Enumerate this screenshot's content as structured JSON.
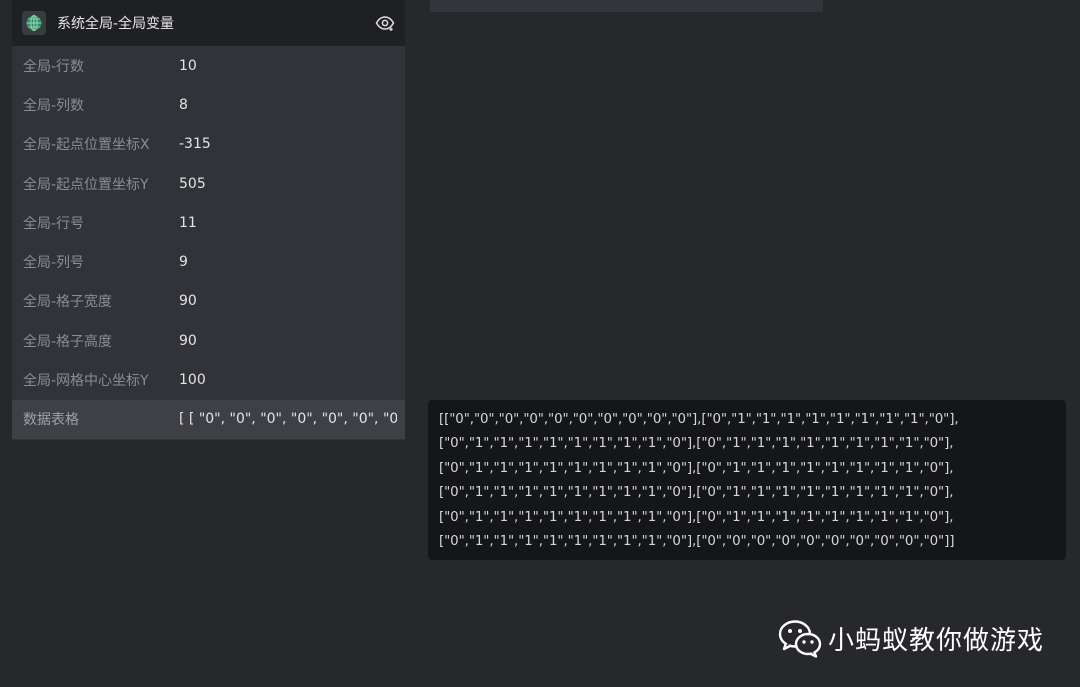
{
  "panel": {
    "title": "系统全局-全局变量",
    "variables": [
      {
        "name": "全局-行数",
        "value": "10"
      },
      {
        "name": "全局-列数",
        "value": "8"
      },
      {
        "name": "全局-起点位置坐标X",
        "value": "-315"
      },
      {
        "name": "全局-起点位置坐标Y",
        "value": "505"
      },
      {
        "name": "全局-行号",
        "value": "11"
      },
      {
        "name": "全局-列号",
        "value": "9"
      },
      {
        "name": "全局-格子宽度",
        "value": "90"
      },
      {
        "name": "全局-格子高度",
        "value": "90"
      },
      {
        "name": "全局-网格中心坐标Y",
        "value": "100"
      },
      {
        "name": "数据表格",
        "value": "[ [ \"0\", \"0\", \"0\", \"0\", \"0\", \"0\", \"0\""
      }
    ]
  },
  "tooltip": {
    "lines": [
      "[[\"0\",\"0\",\"0\",\"0\",\"0\",\"0\",\"0\",\"0\",\"0\",\"0\"],[\"0\",\"1\",\"1\",\"1\",\"1\",\"1\",\"1\",\"1\",\"1\",\"0\"],",
      "[\"0\",\"1\",\"1\",\"1\",\"1\",\"1\",\"1\",\"1\",\"1\",\"0\"],[\"0\",\"1\",\"1\",\"1\",\"1\",\"1\",\"1\",\"1\",\"1\",\"0\"],",
      "[\"0\",\"1\",\"1\",\"1\",\"1\",\"1\",\"1\",\"1\",\"1\",\"0\"],[\"0\",\"1\",\"1\",\"1\",\"1\",\"1\",\"1\",\"1\",\"1\",\"0\"],",
      "[\"0\",\"1\",\"1\",\"1\",\"1\",\"1\",\"1\",\"1\",\"1\",\"0\"],[\"0\",\"1\",\"1\",\"1\",\"1\",\"1\",\"1\",\"1\",\"1\",\"0\"],",
      "[\"0\",\"1\",\"1\",\"1\",\"1\",\"1\",\"1\",\"1\",\"1\",\"0\"],[\"0\",\"1\",\"1\",\"1\",\"1\",\"1\",\"1\",\"1\",\"1\",\"0\"],",
      "[\"0\",\"1\",\"1\",\"1\",\"1\",\"1\",\"1\",\"1\",\"1\",\"0\"],[\"0\",\"0\",\"0\",\"0\",\"0\",\"0\",\"0\",\"0\",\"0\",\"0\"]]"
    ]
  },
  "watermark": {
    "text": "小蚂蚁教你做游戏",
    "icon": "wechat-icon"
  },
  "icons": {
    "header": "globe-icon",
    "toggle": "eye-icon"
  },
  "colors": {
    "background": "#27282c",
    "panel": "#323338",
    "header": "#1f2024",
    "selected_row": "#3f4045",
    "tooltip": "#151619"
  }
}
